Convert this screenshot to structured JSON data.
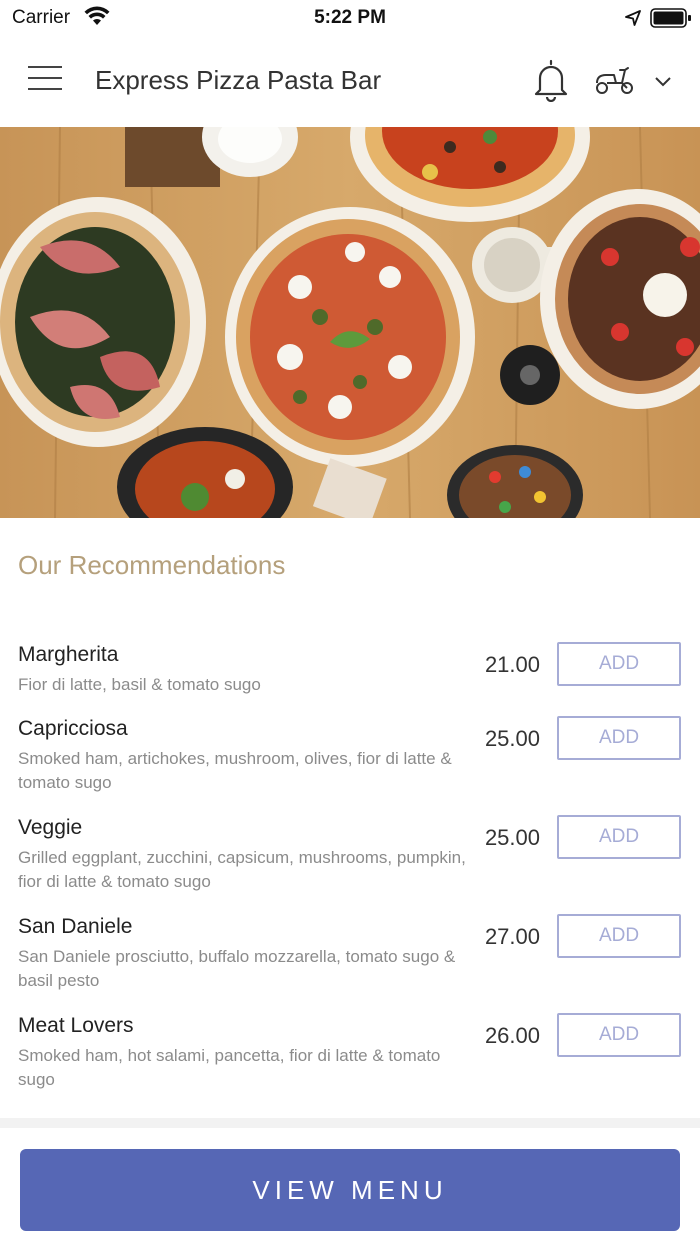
{
  "status_bar": {
    "carrier": "Carrier",
    "time": "5:22 PM"
  },
  "header": {
    "title": "Express Pizza Pasta Bar"
  },
  "section": {
    "title": "Our Recommendations"
  },
  "items": [
    {
      "name": "Margherita",
      "desc": "Fior di latte, basil & tomato sugo",
      "price": "21.00",
      "add_label": "ADD"
    },
    {
      "name": "Capricciosa",
      "desc": "Smoked ham, artichokes, mushroom, olives, fior di latte & tomato sugo",
      "price": "25.00",
      "add_label": "ADD"
    },
    {
      "name": "Veggie",
      "desc": "Grilled eggplant, zucchini, capsicum, mushrooms, pumpkin, fior di latte & tomato sugo",
      "price": "25.00",
      "add_label": "ADD"
    },
    {
      "name": "San Daniele",
      "desc": "San Daniele prosciutto, buffalo mozzarella, tomato sugo & basil pesto",
      "price": "27.00",
      "add_label": "ADD"
    },
    {
      "name": "Meat Lovers",
      "desc": "Smoked ham, hot salami, pancetta, fior di latte & tomato sugo",
      "price": "26.00",
      "add_label": "ADD"
    }
  ],
  "footer": {
    "view_menu_label": "VIEW MENU"
  },
  "colors": {
    "accent": "#5667b5",
    "section_title": "#b5a07c",
    "add_border": "#a6acd6"
  },
  "icons": [
    "wifi-icon",
    "location-arrow-icon",
    "battery-icon",
    "hamburger-menu-icon",
    "bell-icon",
    "scooter-icon",
    "chevron-down-icon"
  ]
}
